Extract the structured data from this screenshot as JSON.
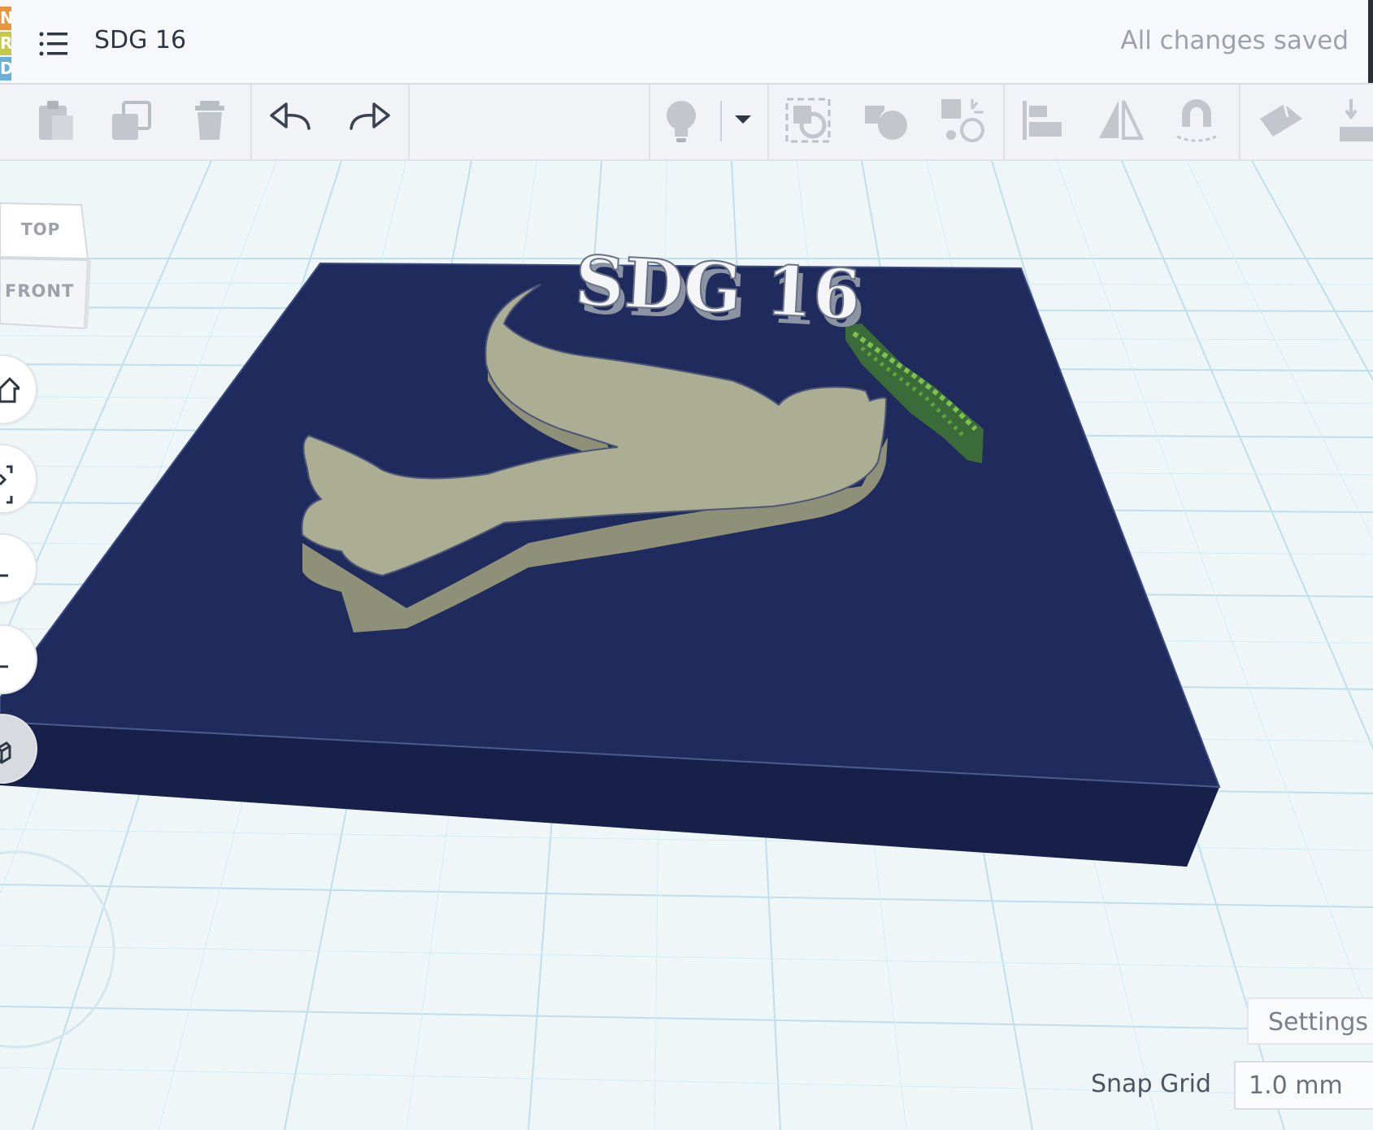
{
  "app": {
    "logo_letters": [
      "N",
      "R",
      "D"
    ],
    "logo_colors": [
      "#e8973f",
      "#c6c84a",
      "#69b0d8"
    ],
    "menu_icon": "list-icon",
    "title": "SDG 16",
    "save_status": "All changes saved"
  },
  "toolbar": {
    "items": [
      {
        "name": "copy-button",
        "icon": "clipboard-icon"
      },
      {
        "name": "paste-button",
        "icon": "duplicate-icon"
      },
      {
        "name": "delete-button",
        "icon": "trash-icon"
      },
      {
        "name": "undo-button",
        "icon": "undo-arrow-icon"
      },
      {
        "name": "redo-button",
        "icon": "redo-arrow-icon"
      },
      {
        "name": "show-notes-button",
        "icon": "lightbulb-icon"
      },
      {
        "name": "notes-dropdown-button",
        "icon": "caret-down-icon"
      },
      {
        "name": "group-button",
        "icon": "group-icon"
      },
      {
        "name": "ungroup-button",
        "icon": "ungroup-icon"
      },
      {
        "name": "hole-button",
        "icon": "hole-icon"
      },
      {
        "name": "align-button",
        "icon": "align-icon"
      },
      {
        "name": "mirror-button",
        "icon": "mirror-icon"
      },
      {
        "name": "cruise-button",
        "icon": "magnet-icon"
      },
      {
        "name": "workplane-button",
        "icon": "workplane-icon"
      },
      {
        "name": "ruler-button",
        "icon": "ruler-icon"
      }
    ]
  },
  "viewcube": {
    "top_label": "TOP",
    "front_label": "FRONT"
  },
  "nav": {
    "items": [
      "home-view-icon",
      "fit-view-icon",
      "zoom-in-icon",
      "zoom-out-icon",
      "perspective-icon"
    ]
  },
  "scene": {
    "plate_text": "SDG 16",
    "plate_color": "#1f2b5c",
    "dove_color": "#acae94",
    "branch_color": "#5fa33a",
    "grid_color": "#bfe0ea"
  },
  "bottom": {
    "settings_label": "Settings",
    "snap_label": "Snap Grid",
    "snap_value": "1.0 mm"
  }
}
